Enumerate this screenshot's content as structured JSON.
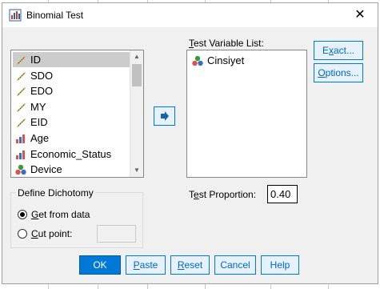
{
  "dialog": {
    "title": "Binomial Test",
    "close_glyph": "✕"
  },
  "variables": [
    {
      "label": "ID",
      "icon": "scale-icon",
      "selected": true
    },
    {
      "label": "SDO",
      "icon": "scale-icon",
      "selected": false
    },
    {
      "label": "EDO",
      "icon": "scale-icon",
      "selected": false
    },
    {
      "label": "MY",
      "icon": "scale-icon",
      "selected": false
    },
    {
      "label": "EID",
      "icon": "scale-icon",
      "selected": false
    },
    {
      "label": "Age",
      "icon": "ordinal-icon",
      "selected": false
    },
    {
      "label": "Economic_Status",
      "icon": "ordinal-icon",
      "selected": false
    },
    {
      "label": "Device",
      "icon": "nominal-icon",
      "selected": false
    }
  ],
  "test_list": {
    "label_pre": "",
    "label_u": "T",
    "label_post": "est Variable List:",
    "items": [
      {
        "label": "Cinsiyet",
        "icon": "nominal-icon"
      }
    ]
  },
  "side_buttons": {
    "exact_u": "x",
    "exact_pre": "E",
    "exact_post": "act...",
    "options_u": "O",
    "options_post": "ptions..."
  },
  "move_button_glyph": "➜",
  "dichotomy": {
    "title": "Define Dichotomy",
    "get_from_data_u": "G",
    "get_from_data_post": "et from data",
    "get_from_data_selected": true,
    "cut_point_u": "C",
    "cut_point_post": "ut point:",
    "cut_point_value": ""
  },
  "proportion": {
    "label_pre": "T",
    "label_u": "e",
    "label_post": "st Proportion:",
    "value": "0.40"
  },
  "bottom_buttons": {
    "ok": "OK",
    "paste_u": "P",
    "paste_post": "aste",
    "reset_u": "R",
    "reset_post": "eset",
    "cancel": "Cancel",
    "help": "Help"
  },
  "colors": {
    "accent": "#0078d7",
    "selected_row": "#cccccc",
    "dialog_bg": "#f0f0f0"
  }
}
